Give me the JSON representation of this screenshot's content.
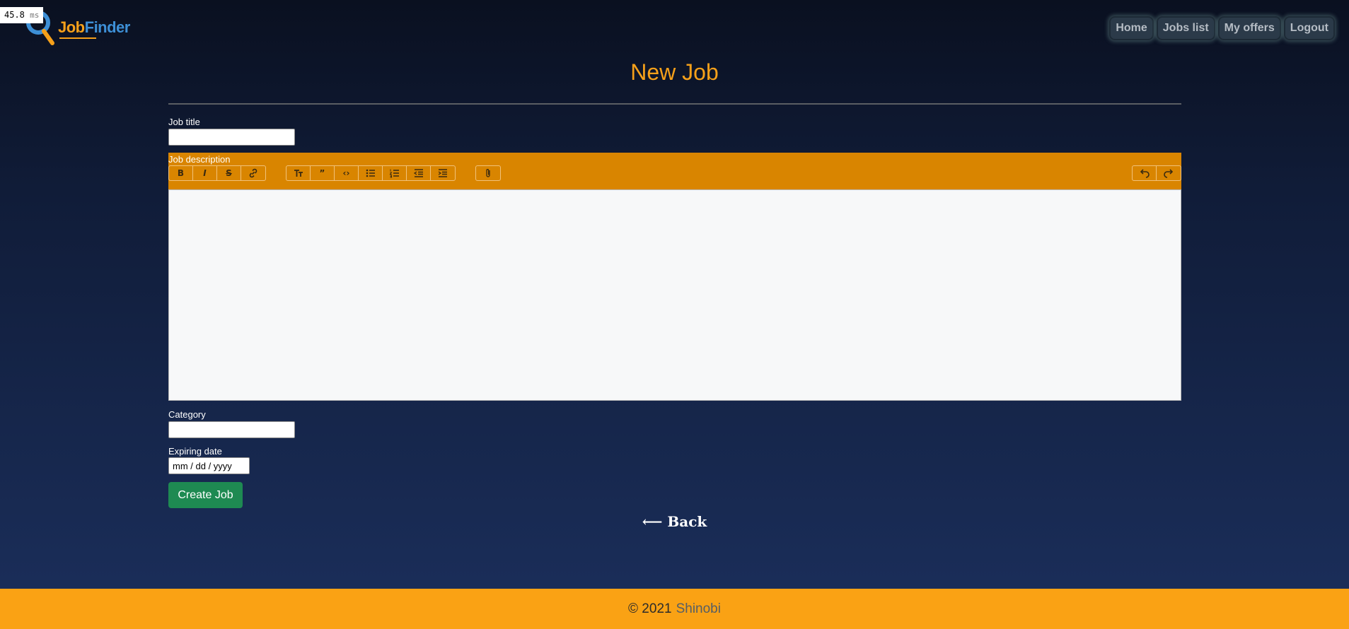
{
  "debug": {
    "timer_value": "45.8",
    "timer_unit": "ms"
  },
  "brand": {
    "name_part1": "Job",
    "name_part2": "Finder",
    "accent": "#f5a01a",
    "secondary": "#3d8fd6"
  },
  "nav": {
    "items": [
      {
        "label": "Home"
      },
      {
        "label": "Jobs list"
      },
      {
        "label": "My offers"
      },
      {
        "label": "Logout"
      }
    ]
  },
  "page": {
    "title": "New Job"
  },
  "form": {
    "job_title": {
      "label": "Job title",
      "value": ""
    },
    "job_description": {
      "label": "Job description",
      "toolbar": {
        "text_tools": [
          "bold-icon",
          "italic-icon",
          "strikethrough-icon",
          "link-icon"
        ],
        "block_tools": [
          "heading-icon",
          "quote-icon",
          "code-icon",
          "bullet-list-icon",
          "numbered-list-icon",
          "decrease-indent-icon",
          "increase-indent-icon"
        ],
        "file_tools": [
          "attach-file-icon"
        ],
        "history_tools": [
          "undo-icon",
          "redo-icon"
        ]
      },
      "value": ""
    },
    "category": {
      "label": "Category",
      "value": ""
    },
    "expiring_date": {
      "label": "Expiring date",
      "placeholder": "mm / dd / yyyy"
    },
    "submit_label": "Create Job"
  },
  "back_label": "⟵ Back",
  "footer": {
    "copyright": "© 2021",
    "author": "Shinobi"
  },
  "colors": {
    "toolbar": "#d98500",
    "submit": "#1e8a52",
    "footer": "#faa214"
  }
}
